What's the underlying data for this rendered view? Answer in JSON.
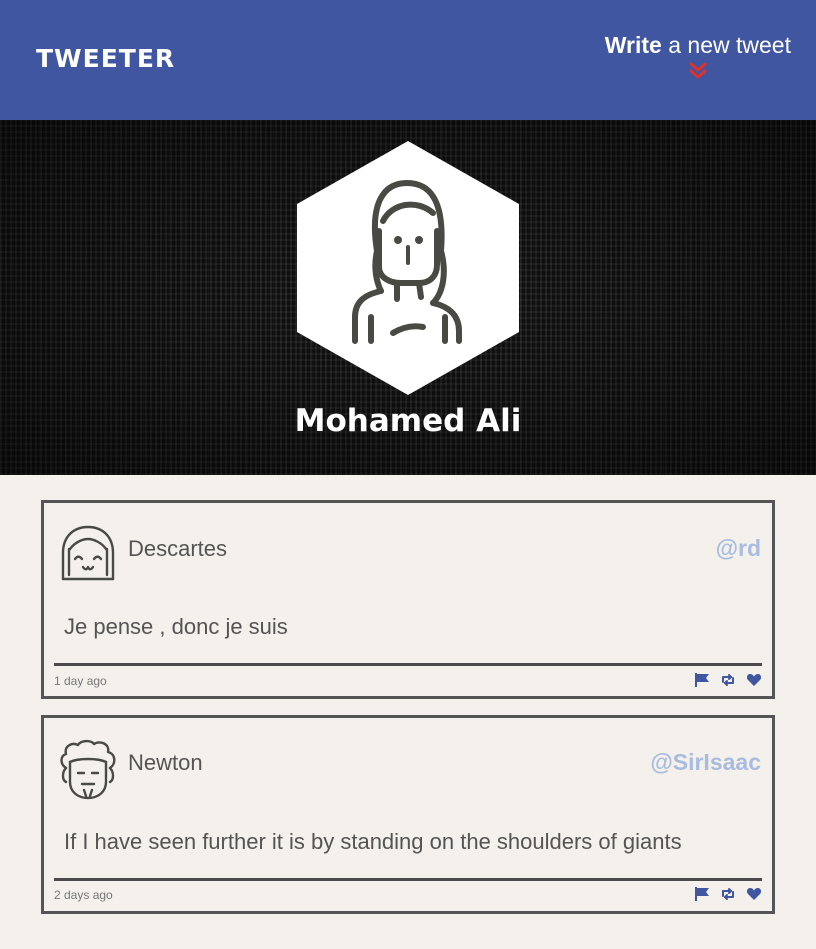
{
  "brand": {
    "logo": "TWEETER"
  },
  "compose": {
    "bold": "Write",
    "rest": " a new tweet",
    "icon": "double-chevron-down-icon",
    "icon_color": "#e0312b"
  },
  "profile": {
    "name": "Mohamed Ali",
    "avatar": "woman-avatar"
  },
  "colors": {
    "nav": "#4056a1",
    "page": "#f4f1ec",
    "handle": "#a9bce0",
    "action": "#4056a1",
    "border": "#555555"
  },
  "tweets": [
    {
      "name": "Descartes",
      "handle": "@rd",
      "text": "Je pense , donc je suis",
      "time": "1 day ago",
      "avatar": "smiling-face-avatar",
      "actions": [
        "flag-icon",
        "retweet-icon",
        "heart-icon"
      ]
    },
    {
      "name": "Newton",
      "handle": "@SirIsaac",
      "text": "If I have seen further it is by standing on the shoulders of giants",
      "time": "2 days ago",
      "avatar": "curly-hair-avatar",
      "actions": [
        "flag-icon",
        "retweet-icon",
        "heart-icon"
      ]
    }
  ]
}
